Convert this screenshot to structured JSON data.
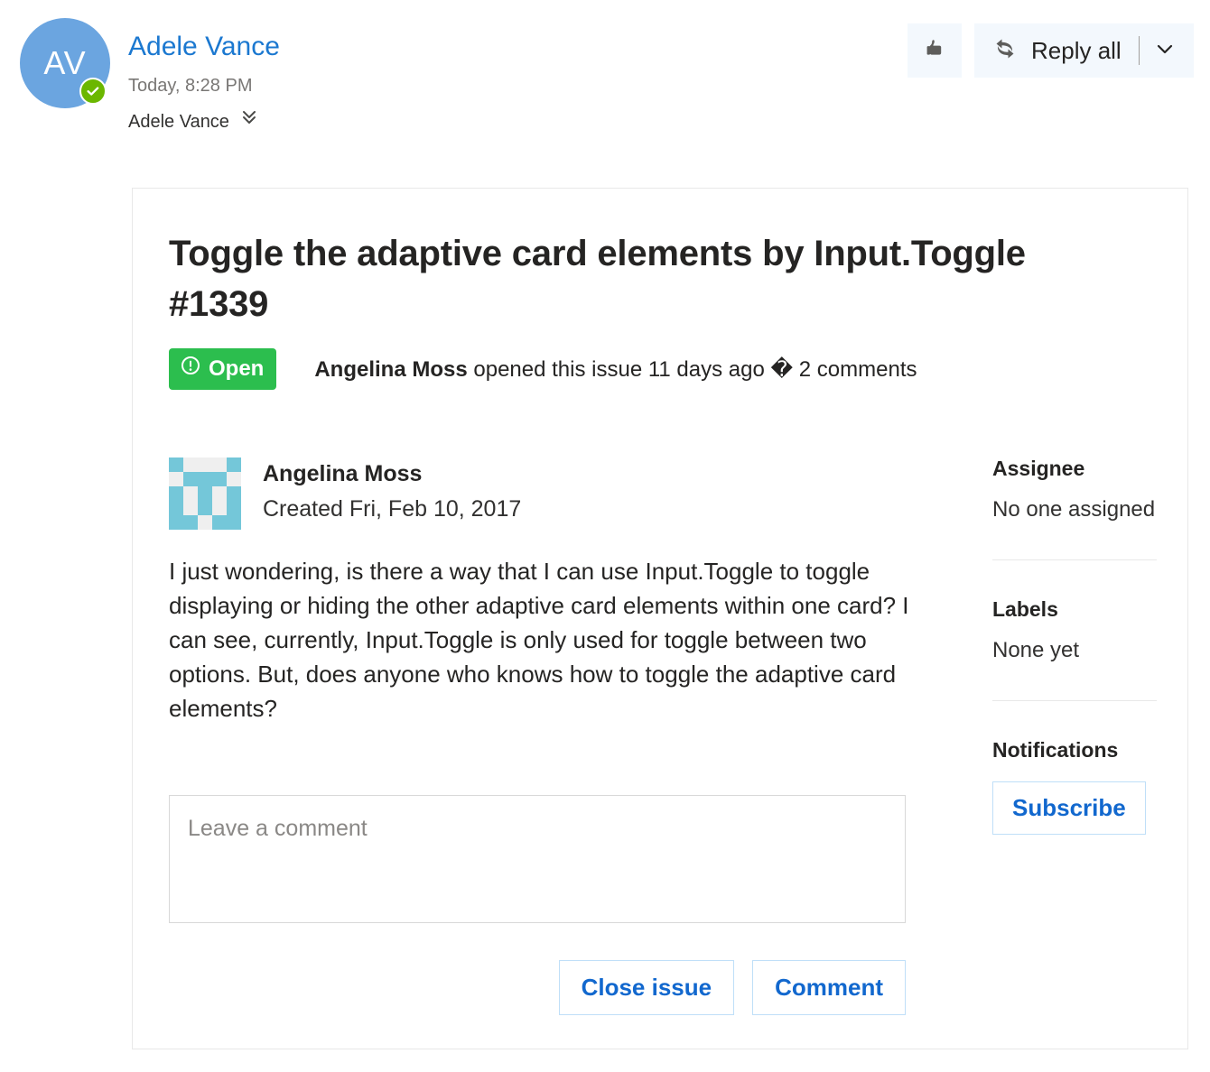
{
  "email": {
    "sender_initials": "AV",
    "sender_name": "Adele Vance",
    "timestamp": "Today, 8:28 PM",
    "recipients": "Adele Vance",
    "presence_icon": "available-check-icon",
    "expand_icon": "double-chevron-down-icon"
  },
  "toolbar": {
    "like_icon": "thumbs-up-icon",
    "reply_all_icon": "reply-all-icon",
    "reply_all_label": "Reply all",
    "caret_icon": "chevron-down-icon"
  },
  "issue": {
    "title": "Toggle the adaptive card elements by Input.Toggle #1339",
    "state_label": "Open",
    "state_icon": "issue-open-circle-icon",
    "state_color": "#2cbe4e",
    "meta_author": "Angelina Moss",
    "meta_action": " opened this issue 11 days ago ",
    "meta_separator": "�",
    "meta_comments": " 2 comments",
    "comment": {
      "avatar_icon": "identicon-avatar",
      "avatar_color": "#74c7d9",
      "author": "Angelina Moss",
      "created": "Created Fri, Feb 10, 2017",
      "body": "I just wondering, is there a way that I can use Input.Toggle to toggle displaying or hiding the other adaptive card elements within one card? I can see, currently, Input.Toggle is only used for toggle between two options. But, does anyone who knows how to toggle the adaptive card elements?"
    },
    "comment_box_placeholder": "Leave a comment",
    "comment_box_value": "",
    "close_issue_label": "Close issue",
    "comment_label": "Comment"
  },
  "sidebar": {
    "assignee_heading": "Assignee",
    "assignee_value": "No one assigned",
    "labels_heading": "Labels",
    "labels_value": "None yet",
    "notifications_heading": "Notifications",
    "subscribe_label": "Subscribe"
  },
  "identicon_grid": [
    [
      1,
      0,
      0,
      0,
      1
    ],
    [
      0,
      1,
      1,
      1,
      0
    ],
    [
      1,
      0,
      1,
      0,
      1
    ],
    [
      1,
      0,
      1,
      0,
      1
    ],
    [
      1,
      1,
      0,
      1,
      1
    ]
  ]
}
